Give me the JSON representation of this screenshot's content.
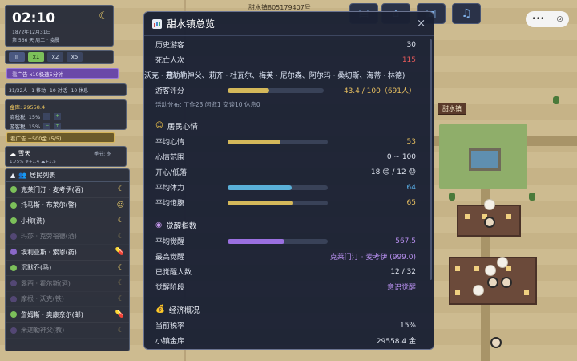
{
  "hud": {
    "time": "02:10",
    "date_line1": "1872年12月31日",
    "date_line2": "第 566 天 周二 · 凌晨"
  },
  "speed": {
    "pause": "II",
    "options": [
      "x1",
      "x2",
      "x5"
    ],
    "active": "x1"
  },
  "ad_speed": "看广告 x10极速5分钟",
  "stats": {
    "residents": "31/32人",
    "move": "1 移动",
    "tasks": "10 对话",
    "rest": "10 休息"
  },
  "economy": {
    "gold": "金库: 29558.4",
    "trade": "商税税: 15%",
    "tourism": "游客税: 15%",
    "minus": "−",
    "plus": "+"
  },
  "ad_gold": "看广告 +500金 (5/5)",
  "weather": {
    "name": "雪天",
    "detail": "1.75% ❄+1.4 ☁+1.5",
    "season": "季节: 冬"
  },
  "residents_panel": {
    "title": "居民列表",
    "items": [
      {
        "name": "克莱门汀 · 麦考伊(酒)",
        "icon": "moon",
        "dim": false,
        "color": "green"
      },
      {
        "name": "托马斯 · 布莱尔(警)",
        "icon": "face",
        "dim": false,
        "color": "green"
      },
      {
        "name": "小柳(洗)",
        "icon": "moon",
        "dim": false,
        "color": "green"
      },
      {
        "name": "玛莎 · 克劳福德(酒)",
        "icon": "moon",
        "dim": true,
        "color": "purple"
      },
      {
        "name": "埃利亚斯 · 索恩(药)",
        "icon": "pill",
        "dim": false,
        "color": "purple"
      },
      {
        "name": "沉默乔(马)",
        "icon": "moon",
        "dim": false,
        "color": "green"
      },
      {
        "name": "露西 · 霍尔斯(酒)",
        "icon": "moon",
        "dim": true,
        "color": "purple"
      },
      {
        "name": "摩根 · 沃克(铁)",
        "icon": "moon",
        "dim": true,
        "color": "purple"
      },
      {
        "name": "詹姆斯 · 奥康奈尔(邮)",
        "icon": "pill",
        "dim": false,
        "color": "green"
      },
      {
        "name": "米迦勒神父(教)",
        "icon": "moon",
        "dim": true,
        "color": "purple"
      }
    ]
  },
  "top": {
    "town_id": "甜水镇805179407号",
    "music_icon": "♫"
  },
  "map": {
    "sign": "甜水镇"
  },
  "dialog": {
    "title": "甜水镇总览",
    "close": "×",
    "rows_top": [
      {
        "label": "历史游客",
        "value": "30"
      },
      {
        "label": "死亡人次",
        "value": "115"
      }
    ],
    "overlap_line": "沃克 · 弗勒勒神父、莉齐 · 杜瓦尔、梅芙 · 尼尔森、阿尔玛 · 桑切斯、海蒂 · 林德)",
    "overlap_prefix": "已",
    "visitor_score": {
      "label": "游客评分",
      "value": "43.4 / 100（691人）",
      "fraction": 0.434
    },
    "activity": "活动分布: 工作23  闲逛1  交谈10  休息0",
    "mood_title": "居民心情",
    "mood_rows": [
      {
        "label": "平均心情",
        "value": "53",
        "fraction": 0.53,
        "type": "bar",
        "color": "#d4b85a"
      },
      {
        "label": "心情范围",
        "value": "0 ~ 100",
        "type": "text"
      },
      {
        "label": "开心/低落",
        "value": "18 😊 / 12 😟",
        "type": "text"
      },
      {
        "label": "平均体力",
        "value": "64",
        "fraction": 0.64,
        "type": "bar",
        "color": "#5ab0d8"
      },
      {
        "label": "平均饱腹",
        "value": "65",
        "fraction": 0.65,
        "type": "bar",
        "color": "#d4b85a"
      }
    ],
    "awake_title": "觉醒指数",
    "awake_rows": [
      {
        "label": "平均觉醒",
        "value": "567.5",
        "fraction": 0.57,
        "type": "bar",
        "color": "#9a70e0"
      },
      {
        "label": "最高觉醒",
        "value": "克莱门汀 · 麦考伊 (999.0)",
        "type": "text"
      },
      {
        "label": "已觉醒人数",
        "value": "12 / 32",
        "type": "text"
      },
      {
        "label": "觉醒阶段",
        "value": "意识觉醒",
        "type": "text"
      }
    ],
    "econ_title": "经济概况",
    "econ_rows": [
      {
        "label": "当前税率",
        "value": "15%"
      },
      {
        "label": "小镇金库",
        "value": "29558.4 金"
      }
    ]
  }
}
